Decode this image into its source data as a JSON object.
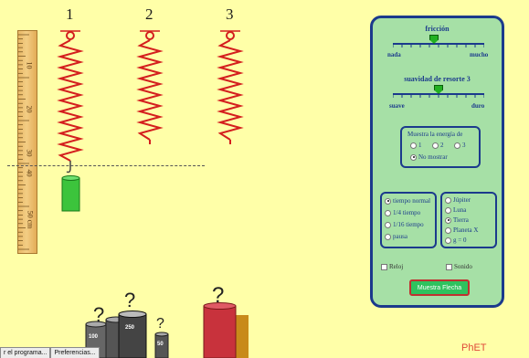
{
  "springs": {
    "labels": [
      "1",
      "2",
      "3"
    ]
  },
  "ruler": {
    "labels": [
      "10",
      "20",
      "30",
      "40",
      "50 cm"
    ]
  },
  "panel": {
    "friction": {
      "title": "fricción",
      "min_label": "nada",
      "max_label": "mucho",
      "value": 0.45
    },
    "softness": {
      "title": "suavidad de resorte 3",
      "min_label": "suave",
      "max_label": "duro",
      "value": 0.5
    },
    "energy": {
      "title": "Muestra la energía de",
      "options": [
        "1",
        "2",
        "3"
      ],
      "no_show_label": "No mostrar"
    },
    "time": {
      "options": [
        "tiempo normal",
        "1/4 tiempo",
        "1/16 tiempo",
        "pausa"
      ],
      "selected": 0
    },
    "planet": {
      "options": [
        "Júpiter",
        "Luna",
        "Tierra",
        "Planeta X",
        "g = 0"
      ],
      "selected": 2
    },
    "show_arrow_label": "Muestra Flecha"
  },
  "side": {
    "clock_label": "Reloj",
    "sound_label": "Sonido"
  },
  "weights": {
    "labels": [
      "100",
      "250",
      "50"
    ]
  },
  "taskbar": {
    "tabs": [
      "r el programa...",
      "Preferencias..."
    ]
  },
  "logo": "PhET",
  "colors": {
    "background": "#ffffa8",
    "spring": "#d41e1e",
    "panel": "#a6e0a6",
    "panel_border": "#1b3a8c",
    "button": "#2ec25e",
    "green_mass": "#3cc43c",
    "red_mass": "#c8323c"
  }
}
